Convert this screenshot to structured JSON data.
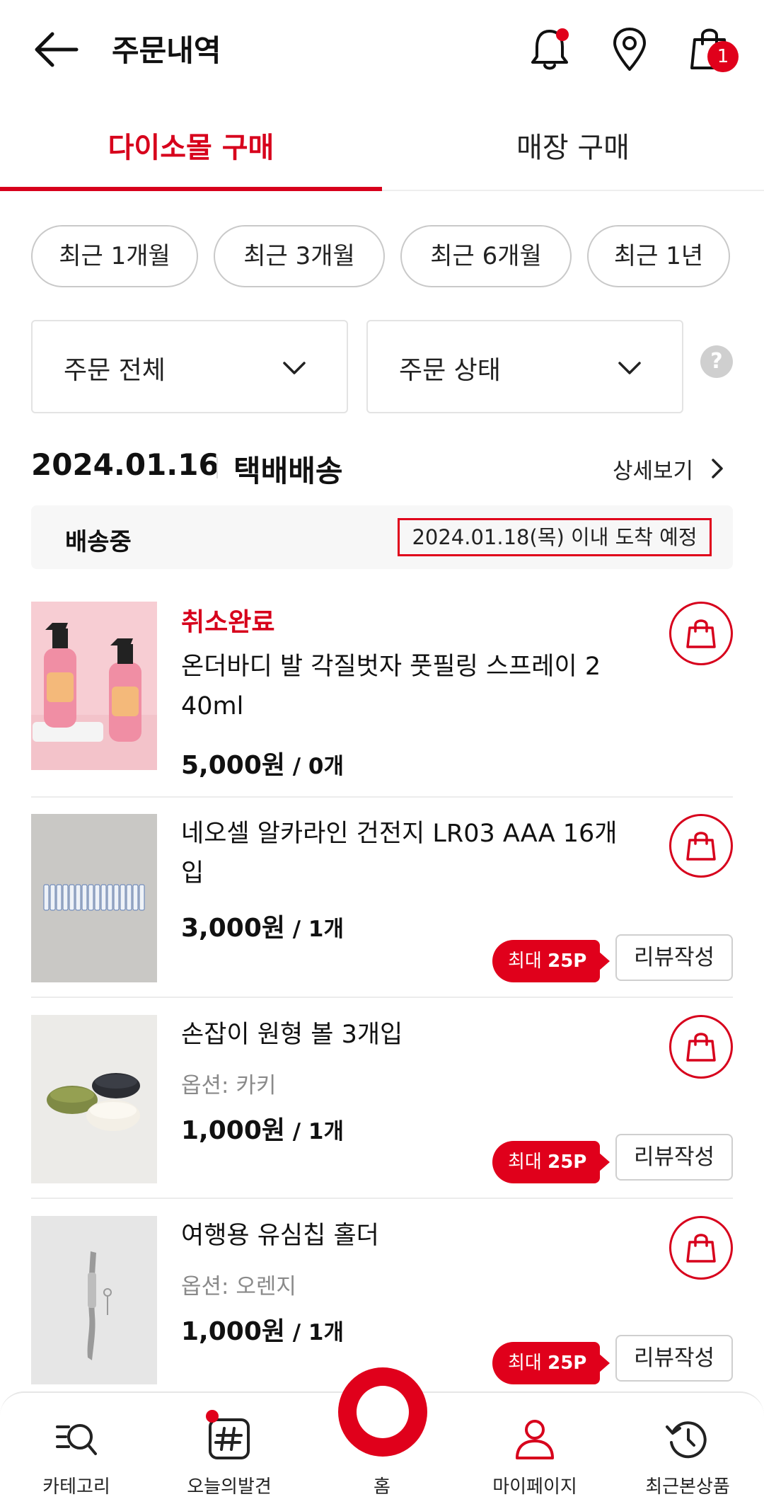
{
  "header": {
    "title": "주문내역",
    "cart_count": "1"
  },
  "tabs": [
    {
      "label": "다이소몰 구매",
      "active": true
    },
    {
      "label": "매장 구매",
      "active": false
    }
  ],
  "period_chips": [
    "최근 1개월",
    "최근 3개월",
    "최근 6개월",
    "최근 1년"
  ],
  "filters": {
    "order_scope": "주문 전체",
    "order_status": "주문 상태",
    "help": "?"
  },
  "order": {
    "date": "2024.01.16",
    "type": "택배배송",
    "detail_link": "상세보기",
    "status": "배송중",
    "eta": "2024.01.18(목) 이내 도착 예정"
  },
  "items": [
    {
      "status": "취소완료",
      "name": "온더바디 발 각질벗자 풋필링 스프레이 240ml",
      "name_line1": "온더바디 발 각질벗자 풋필링 스프레이 2",
      "name_line2": "40ml",
      "price": "5,000원",
      "qty": " / 0개"
    },
    {
      "name": "네오셀 알카라인 건전지 LR03 AAA 16개입",
      "name_line1": "네오셀 알카라인 건전지 LR03 AAA 16개",
      "name_line2": "입",
      "price": "3,000원",
      "qty": " / 1개",
      "point_prefix": "최대 ",
      "point": "25P",
      "review": "리뷰작성"
    },
    {
      "name": "손잡이 원형 볼 3개입",
      "option": "옵션: 카키",
      "price": "1,000원",
      "qty": " / 1개",
      "point_prefix": "최대 ",
      "point": "25P",
      "review": "리뷰작성"
    },
    {
      "name": "여행용 유심칩 홀더",
      "option": "옵션: 오렌지",
      "price": "1,000원",
      "qty": " / 1개",
      "point_prefix": "최대 ",
      "point": "25P",
      "review": "리뷰작성"
    }
  ],
  "bottom_nav": [
    {
      "label": "카테고리",
      "icon": "category-search-icon"
    },
    {
      "label": "오늘의발견",
      "icon": "hashtag-icon"
    },
    {
      "label": "홈",
      "icon": "home-circle-icon"
    },
    {
      "label": "마이페이지",
      "icon": "person-icon"
    },
    {
      "label": "최근본상품",
      "icon": "history-icon"
    }
  ],
  "colors": {
    "accent": "#d7001c",
    "badge": "#e0001b"
  }
}
